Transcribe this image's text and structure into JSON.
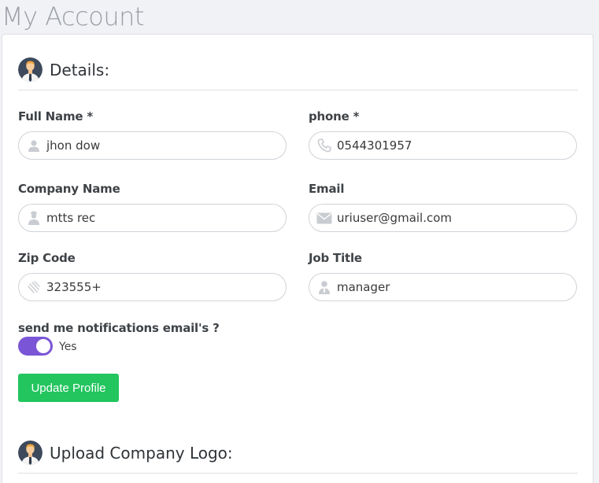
{
  "page": {
    "title": "My Account"
  },
  "details_section": {
    "title": "Details:"
  },
  "fields": {
    "full_name": {
      "label": "Full Name *",
      "value": "jhon dow",
      "icon": "user-icon"
    },
    "phone": {
      "label": "phone *",
      "value": "0544301957",
      "icon": "phone-icon"
    },
    "company_name": {
      "label": "Company Name",
      "value": "mtts rec",
      "icon": "building-user-icon"
    },
    "email": {
      "label": "Email",
      "value": "uriuser@gmail.com",
      "icon": "envelope-icon"
    },
    "zip_code": {
      "label": "Zip Code",
      "value": "323555+",
      "icon": "signature-icon"
    },
    "job_title": {
      "label": "Job Title",
      "value": "manager",
      "icon": "user-tie-icon"
    }
  },
  "notifications": {
    "label": "send me notifications email's ?",
    "toggle_text": "Yes",
    "enabled": true
  },
  "update_button": {
    "label": "Update Profile"
  },
  "upload_section": {
    "title": "Upload Company Logo:"
  },
  "colors": {
    "accent_purple": "#7a55d6",
    "button_green": "#22c55e",
    "page_bg": "#f1f2f5"
  }
}
